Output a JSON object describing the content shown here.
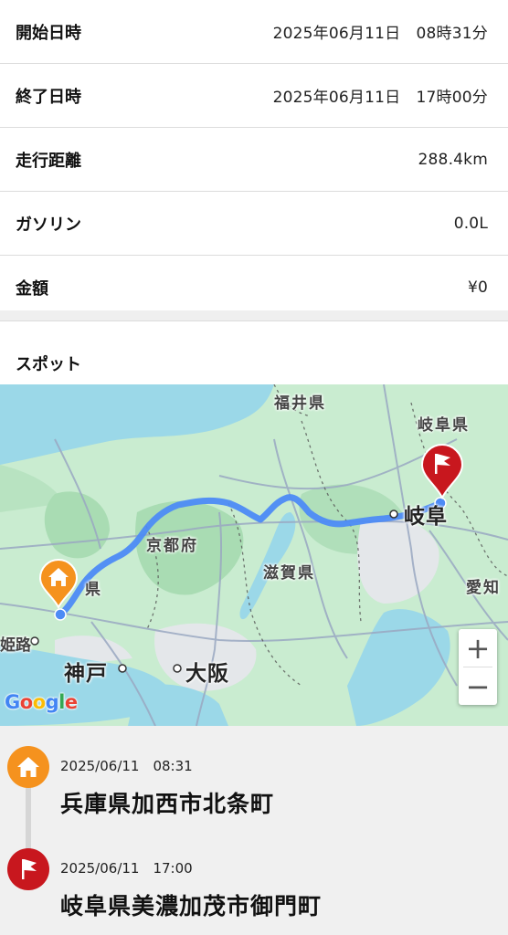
{
  "info_rows": [
    {
      "label": "開始日時",
      "value": "2025年06月11日　08時31分"
    },
    {
      "label": "終了日時",
      "value": "2025年06月11日　17時00分"
    },
    {
      "label": "走行距離",
      "value": "288.4km"
    },
    {
      "label": "ガソリン",
      "value": "0.0L"
    },
    {
      "label": "金額",
      "value": "¥0"
    }
  ],
  "spot_section_title": "スポット",
  "map": {
    "labels": {
      "fukui": "福井県",
      "gifu_pref": "岐阜県",
      "gifu_city": "岐阜",
      "kyoto": "京都府",
      "shiga": "滋賀県",
      "aichi": "愛知",
      "hyogo_partial": "県",
      "himeji_partial": "姫路",
      "kobe": "神戸",
      "osaka": "大阪"
    },
    "zoom_in": "+",
    "zoom_out": "−",
    "attribution": "Google",
    "colors": {
      "route": "#4d8bf5",
      "start_marker": "#f5921e",
      "end_marker": "#c8171e",
      "water": "#9bd8e8",
      "land": "#c9ecd0"
    }
  },
  "timeline": [
    {
      "time": "2025/06/11　08:31",
      "place": "兵庫県加西市北条町",
      "icon": "home-icon",
      "color": "#f5921e"
    },
    {
      "time": "2025/06/11　17:00",
      "place": "岐阜県美濃加茂市御門町",
      "icon": "flag-icon",
      "color": "#c8171e"
    }
  ]
}
